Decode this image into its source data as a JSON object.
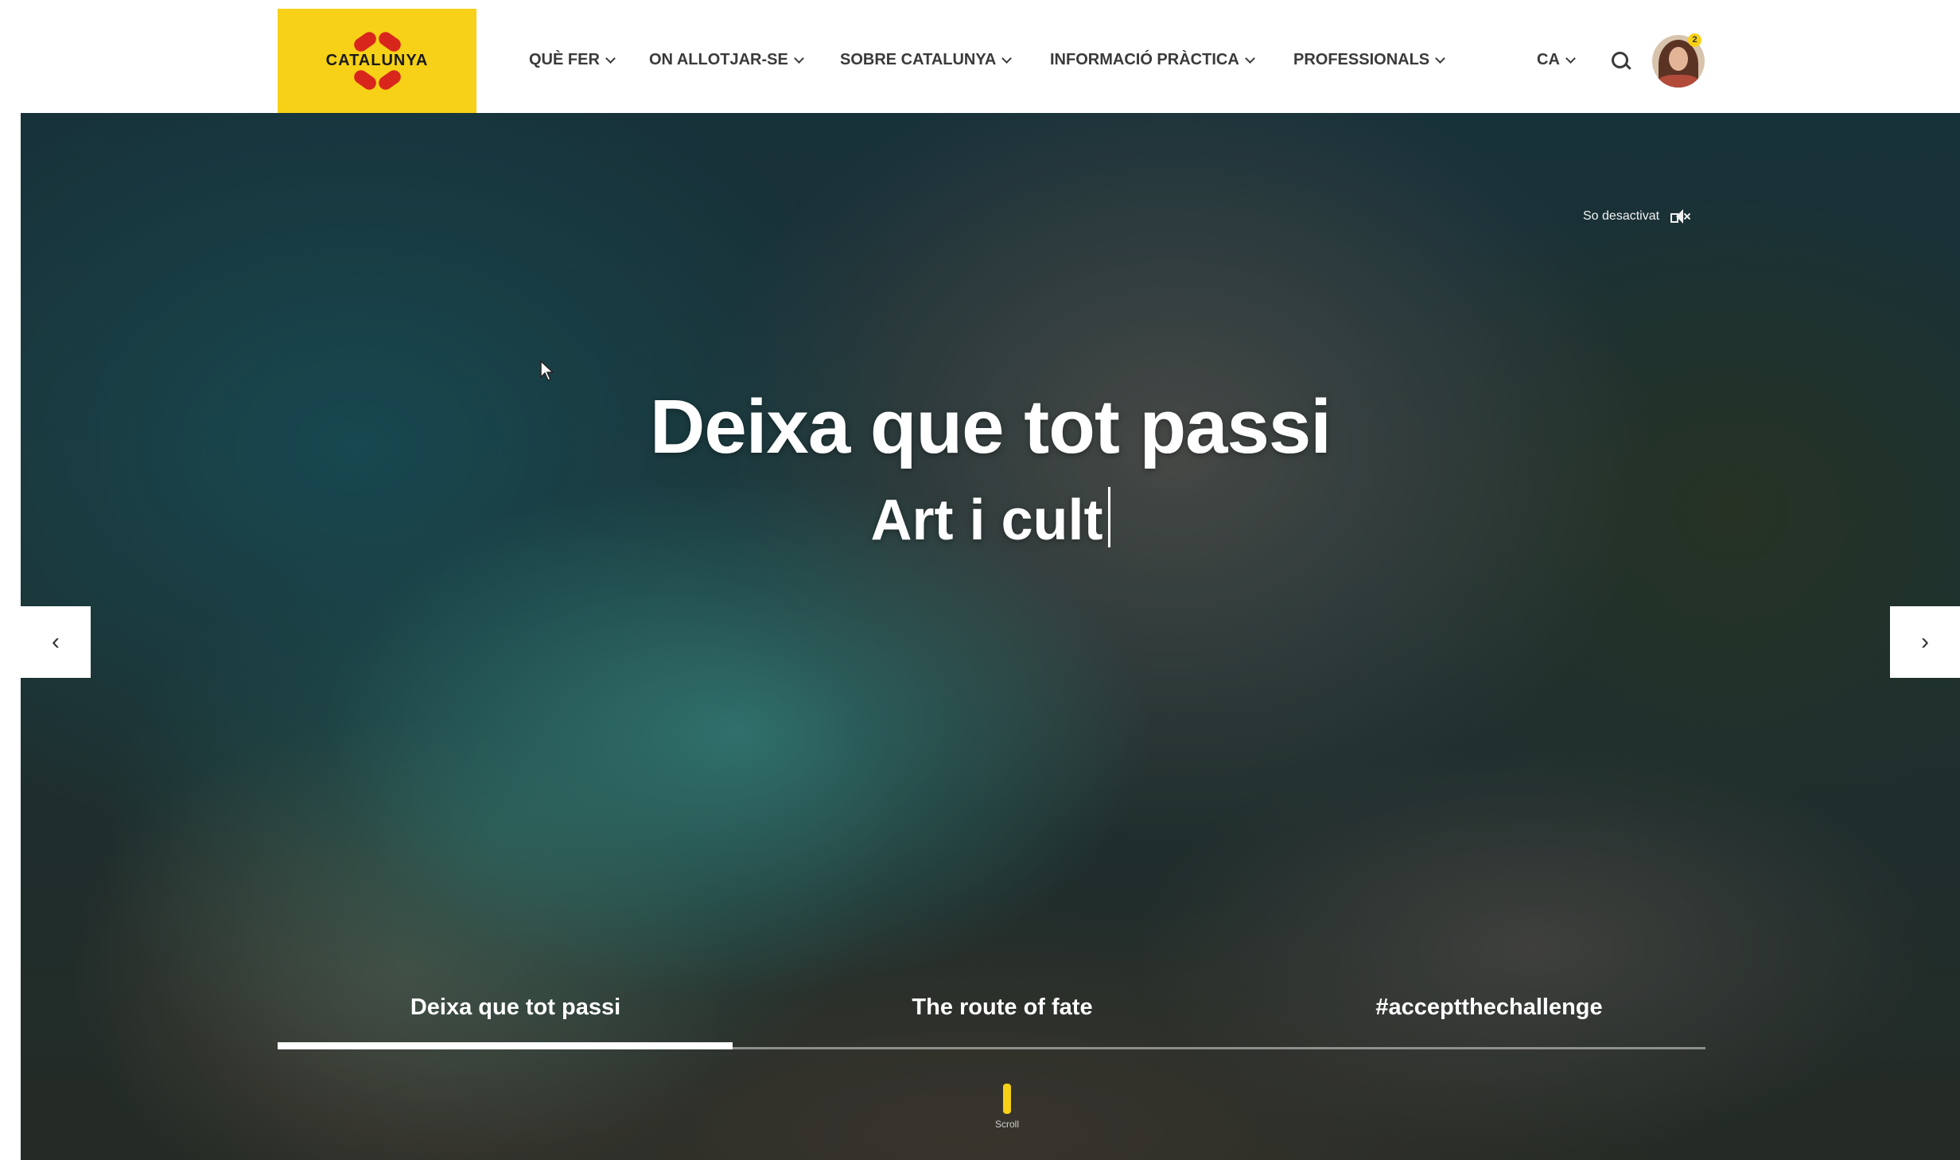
{
  "brand": {
    "logo_text": "CATALUNYA",
    "accent_yellow": "#f7d117",
    "accent_red": "#d9261c"
  },
  "nav": {
    "items": [
      {
        "label": "QUÈ FER"
      },
      {
        "label": "ON ALLOTJAR-SE"
      },
      {
        "label": "SOBRE CATALUNYA"
      },
      {
        "label": "INFORMACIÓ PRÀCTICA"
      },
      {
        "label": "PROFESSIONALS"
      }
    ],
    "language": "CA",
    "search_icon": "search-icon",
    "avatar_badge": "2"
  },
  "hero": {
    "sound_label": "So desactivat",
    "sound_icon": "speaker-muted-icon",
    "title": "Deixa que tot passi",
    "subtitle": "Art i cult",
    "prev_arrow": "‹",
    "next_arrow": "›",
    "tabs": [
      {
        "label": "Deixa que tot passi",
        "active": true
      },
      {
        "label": "The route of fate",
        "active": false
      },
      {
        "label": "#acceptthechallenge",
        "active": false
      }
    ],
    "scroll_label": "Scroll"
  }
}
